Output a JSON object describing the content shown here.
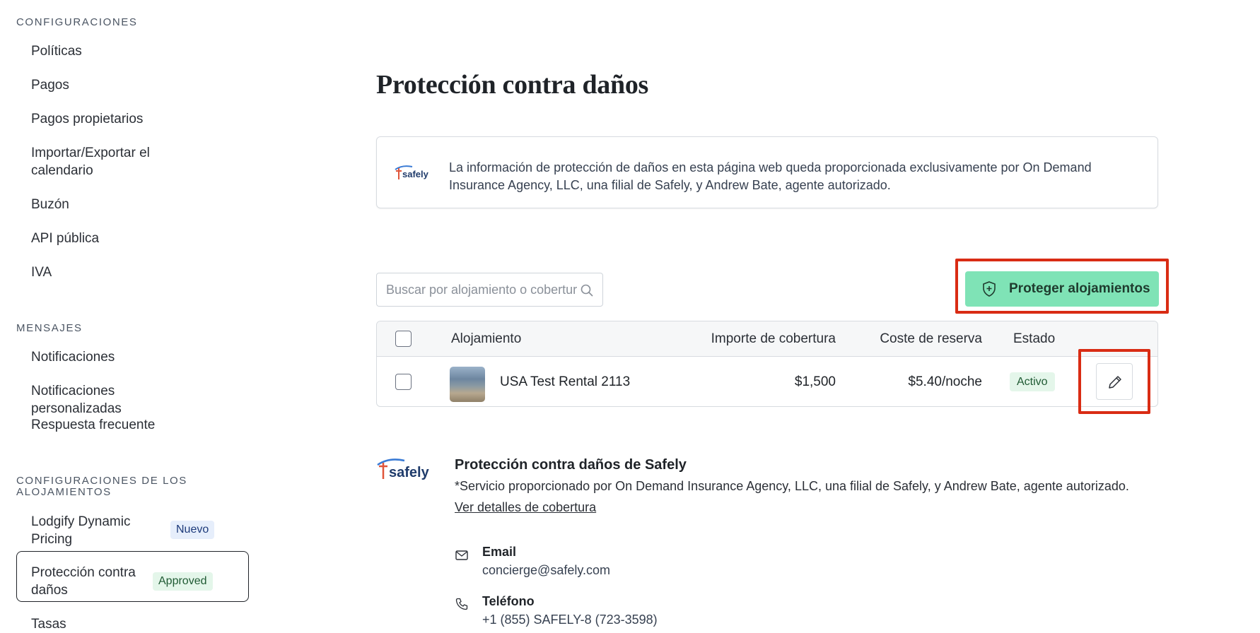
{
  "sidebar": {
    "sections": [
      {
        "title": "CONFIGURACIONES",
        "items": [
          "Políticas",
          "Pagos",
          "Pagos propietarios",
          "Importar/Exportar el calendario",
          "Buzón",
          "API pública",
          "IVA"
        ]
      },
      {
        "title": "MENSAJES",
        "items": [
          "Notificaciones",
          "Notificaciones personalizadas",
          "Respuesta frecuente"
        ]
      },
      {
        "title": "CONFIGURACIONES DE LOS ALOJAMIENTOS",
        "items": [
          {
            "label": "Lodgify Dynamic Pricing",
            "badge": "Nuevo"
          },
          {
            "label": "Protección contra daños",
            "badge": "Approved",
            "active": true
          },
          {
            "label": "Tasas"
          }
        ]
      }
    ]
  },
  "main": {
    "title": "Protección contra daños",
    "info": {
      "logo_text": "safely",
      "text": "La información de protección de daños en esta página web queda proporcionada exclusivamente por On Demand Insurance Agency, LLC, una filial de Safely, y Andrew Bate, agente autorizado."
    },
    "search": {
      "placeholder": "Buscar por alojamiento o cobertura"
    },
    "protect_button": "Proteger alojamientos",
    "table": {
      "headers": [
        "Alojamiento",
        "Importe de cobertura",
        "Coste de reserva",
        "Estado"
      ],
      "rows": [
        {
          "name": "USA Test Rental 2113",
          "coverage": "$1,500",
          "cost": "$5.40/noche",
          "status": "Activo"
        }
      ]
    },
    "safely": {
      "logo_text": "safely",
      "title": "Protección contra daños de Safely",
      "description": "*Servicio proporcionado por On Demand Insurance Agency, LLC, una filial de Safely, y Andrew Bate, agente autorizado.",
      "link": "Ver detalles de cobertura",
      "contacts": [
        {
          "label": "Email",
          "value": "concierge@safely.com",
          "icon": "mail-icon"
        },
        {
          "label": "Teléfono",
          "value": "+1 (855) SAFELY-8 (723-3598)",
          "icon": "phone-icon"
        }
      ]
    }
  },
  "colors": {
    "accent_green": "#7fe3b6",
    "highlight_red": "#d92c14",
    "badge_new_bg": "#e6eefb",
    "badge_approved_bg": "#e4f6ea"
  }
}
